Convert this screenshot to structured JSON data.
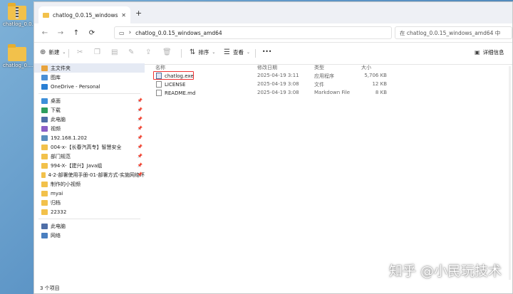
{
  "desktop": {
    "icons": [
      {
        "label": "chatlog_0.0...",
        "icon": "zip-folder-icon"
      },
      {
        "label": "chatlog_0....",
        "icon": "folder-icon"
      }
    ]
  },
  "tabs": [
    {
      "title": "chatlog_0.0.15_windows_amd64",
      "close": "✕"
    }
  ],
  "new_tab": "+",
  "nav": {
    "back": "←",
    "forward": "→",
    "up": "↑",
    "refresh": "⟳",
    "view_toggle": "▭",
    "sep": "›"
  },
  "address": {
    "path": "chatlog_0.0.15_windows_amd64"
  },
  "search": {
    "placeholder": "在 chatlog_0.0.15_windows_amd64 中"
  },
  "toolbar": {
    "new_label": "新建",
    "sort_label": "排序",
    "view_label": "查看",
    "more_label": "•••",
    "details_label": "详细信息"
  },
  "sidebar": {
    "top": [
      {
        "label": "主文件夹",
        "color": "#e8a33d"
      },
      {
        "label": "图库",
        "color": "#4a8fd6"
      },
      {
        "label": "OneDrive - Personal",
        "color": "#2a7fd4"
      }
    ],
    "pinned": [
      {
        "label": "桌面",
        "color": "#3d8fd9"
      },
      {
        "label": "下载",
        "color": "#2e9e5e"
      },
      {
        "label": "此电脑",
        "color": "#4f6fa8"
      },
      {
        "label": "视频",
        "color": "#8b5fc7"
      },
      {
        "label": "192.168.1.202",
        "color": "#5a8fbf"
      },
      {
        "label": "004-x-【长春汽高专】智慧安全",
        "color": "#f2c14b"
      },
      {
        "label": "部门规范",
        "color": "#f2c14b"
      },
      {
        "label": "994-X-【建兴】Java组",
        "color": "#f2c14b"
      },
      {
        "label": "4-2-部署使用手册-01-部署方式-实施网络环",
        "color": "#f2c14b"
      },
      {
        "label": "制作的小视频",
        "color": "#f2c14b"
      },
      {
        "label": "myai",
        "color": "#f2c14b"
      },
      {
        "label": "归档",
        "color": "#f2c14b"
      },
      {
        "label": "22332",
        "color": "#f2c14b"
      }
    ],
    "bottom": [
      {
        "label": "此电脑",
        "color": "#4f6fa8"
      },
      {
        "label": "网络",
        "color": "#4a7fc0"
      }
    ]
  },
  "columns": {
    "name": "名称",
    "date": "修改日期",
    "type": "类型",
    "size": "大小"
  },
  "files": [
    {
      "name": "chatlog.exe",
      "date": "2025-04-19 3:11",
      "type": "应用程序",
      "size": "5,706 KB",
      "kind": "exe"
    },
    {
      "name": "LICENSE",
      "date": "2025-04-19 3:08",
      "type": "文件",
      "size": "12 KB",
      "kind": "file"
    },
    {
      "name": "README.md",
      "date": "2025-04-19 3:08",
      "type": "Markdown File",
      "size": "8 KB",
      "kind": "file"
    }
  ],
  "status": {
    "count": "3 个项目"
  },
  "watermark": "知乎 @小民玩技术"
}
